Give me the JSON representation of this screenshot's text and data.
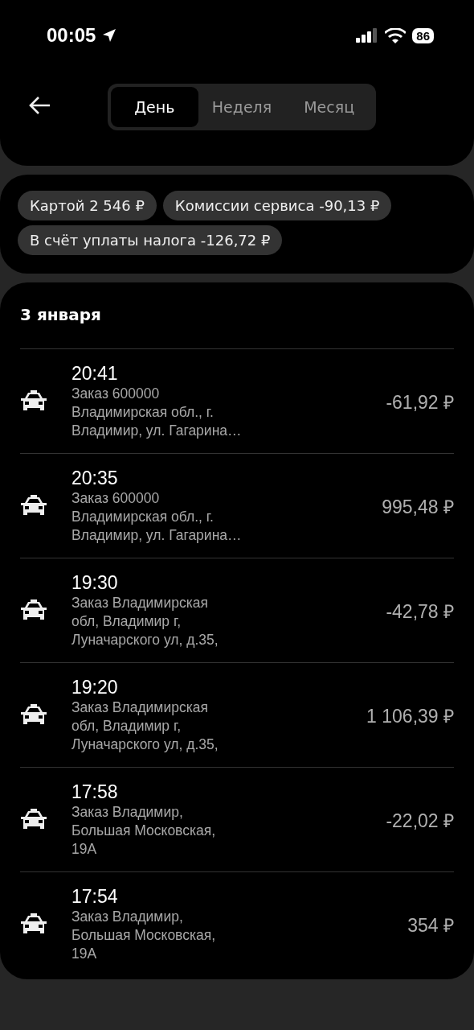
{
  "status_bar": {
    "time": "00:05",
    "battery": "86"
  },
  "tabs": [
    {
      "label": "День",
      "selected": true
    },
    {
      "label": "Неделя",
      "selected": false
    },
    {
      "label": "Месяц",
      "selected": false
    }
  ],
  "summary_chips": [
    "Картой 2 546 ₽",
    "Комиссии сервиса -90,13 ₽",
    "В счёт уплаты налога -126,72 ₽"
  ],
  "date_heading": "3 января",
  "transactions": [
    {
      "time": "20:41",
      "description": "Заказ 600000\nВладимирская обл., г.\nВладимир, ул. Гагарина…",
      "amount": "-61,92 ₽"
    },
    {
      "time": "20:35",
      "description": "Заказ 600000\nВладимирская обл., г.\nВладимир, ул. Гагарина…",
      "amount": "995,48 ₽"
    },
    {
      "time": "19:30",
      "description": "Заказ Владимирская\nобл, Владимир г,\nЛуначарского ул, д.35,",
      "amount": "-42,78 ₽"
    },
    {
      "time": "19:20",
      "description": "Заказ Владимирская\nобл, Владимир г,\nЛуначарского ул, д.35,",
      "amount": "1 106,39 ₽"
    },
    {
      "time": "17:58",
      "description": "Заказ Владимир,\nБольшая Московская,\n19А",
      "amount": "-22,02 ₽"
    },
    {
      "time": "17:54",
      "description": "Заказ Владимир,\nБольшая Московская,\n19А",
      "amount": "354 ₽"
    }
  ]
}
